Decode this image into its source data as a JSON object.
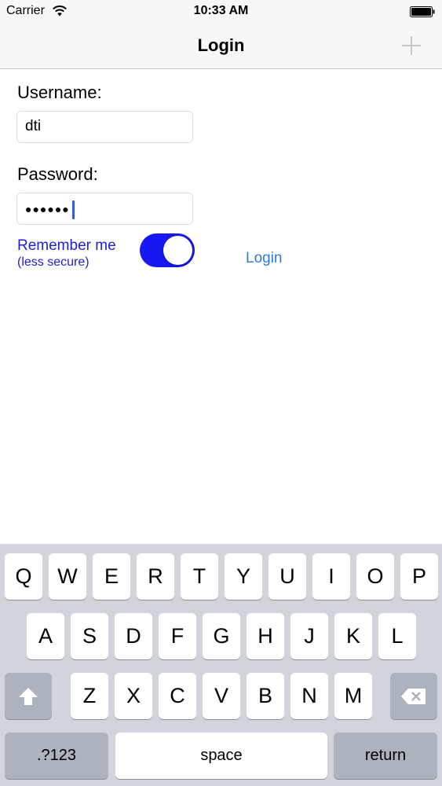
{
  "status_bar": {
    "carrier": "Carrier",
    "time": "10:33 AM"
  },
  "nav": {
    "title": "Login",
    "add_icon": "plus-icon"
  },
  "form": {
    "username_label": "Username:",
    "username_value": "dti",
    "password_label": "Password:",
    "password_masked": "●●●●●●",
    "remember_label": "Remember me",
    "remember_sub": "(less secure)",
    "remember_on": true,
    "login_button": "Login"
  },
  "colors": {
    "toggle_on": "#1717f2",
    "remember_text": "#1f1fcf",
    "login_link": "#2f7bd8",
    "caret": "#3c5ae0"
  },
  "keyboard": {
    "row1": [
      "Q",
      "W",
      "E",
      "R",
      "T",
      "Y",
      "U",
      "I",
      "O",
      "P"
    ],
    "row2": [
      "A",
      "S",
      "D",
      "F",
      "G",
      "H",
      "J",
      "K",
      "L"
    ],
    "row3": [
      "Z",
      "X",
      "C",
      "V",
      "B",
      "N",
      "M"
    ],
    "shift_icon": "shift-icon",
    "delete_icon": "delete-icon",
    "mode_label": ".?123",
    "space_label": "space",
    "return_label": "return"
  }
}
